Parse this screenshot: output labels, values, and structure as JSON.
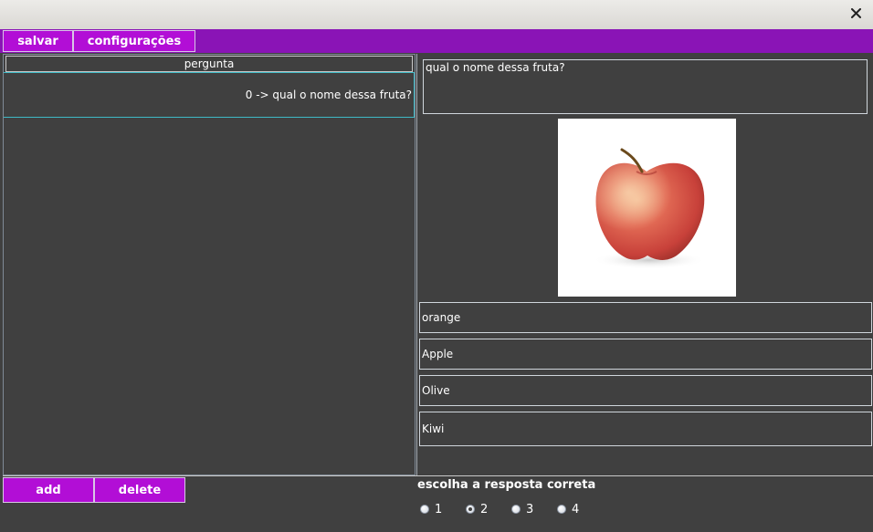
{
  "window": {
    "close_glyph": "✕"
  },
  "menu": {
    "save_label": "salvar",
    "settings_label": "configurações"
  },
  "question_table": {
    "header": "pergunta",
    "rows": [
      "0 -> qual o nome dessa fruta?"
    ]
  },
  "editor": {
    "question_text": "qual o nome dessa fruta?",
    "image_icon": "apple-image",
    "answers": [
      "orange",
      "Apple",
      "Olive",
      "Kiwi"
    ]
  },
  "actions": {
    "add_label": "add",
    "delete_label": "delete"
  },
  "correct_answer": {
    "label": "escolha a resposta correta",
    "options": [
      "1",
      "2",
      "3",
      "4"
    ],
    "selected": "2"
  },
  "colors": {
    "accent": "#b20ed6",
    "menubar": "#8a14b6",
    "background": "#404040"
  }
}
